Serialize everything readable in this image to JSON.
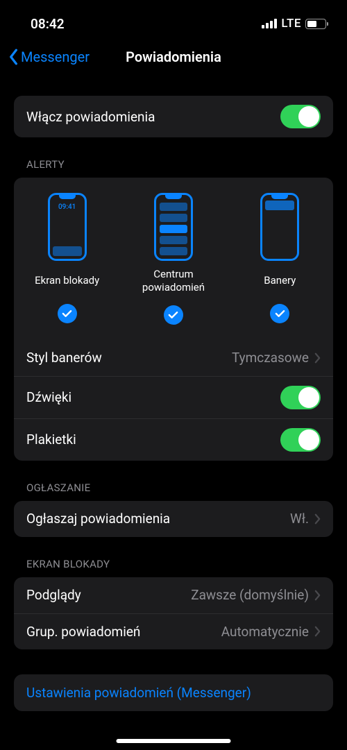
{
  "status": {
    "time": "08:42",
    "network": "LTE"
  },
  "nav": {
    "back": "Messenger",
    "title": "Powiadomienia"
  },
  "enable": {
    "label": "Włącz powiadomienia"
  },
  "sections": {
    "alerts": "Alerty",
    "announce": "Ogłaszanie",
    "lockscreen": "Ekran blokady"
  },
  "alertStyles": {
    "lock": {
      "label": "Ekran blokady",
      "time": "09:41"
    },
    "center": {
      "label": "Centrum powiadomień"
    },
    "banner": {
      "label": "Banery"
    }
  },
  "rows": {
    "bannerStyle": {
      "label": "Styl banerów",
      "value": "Tymczasowe"
    },
    "sounds": {
      "label": "Dźwięki"
    },
    "badges": {
      "label": "Plakietki"
    },
    "announce": {
      "label": "Ogłaszaj powiadomienia",
      "value": "Wł."
    },
    "previews": {
      "label": "Podglądy",
      "value": "Zawsze (domyślnie)"
    },
    "grouping": {
      "label": "Grup. powiadomień",
      "value": "Automatycznie"
    }
  },
  "link": "Ustawienia powiadomień (Messenger)"
}
